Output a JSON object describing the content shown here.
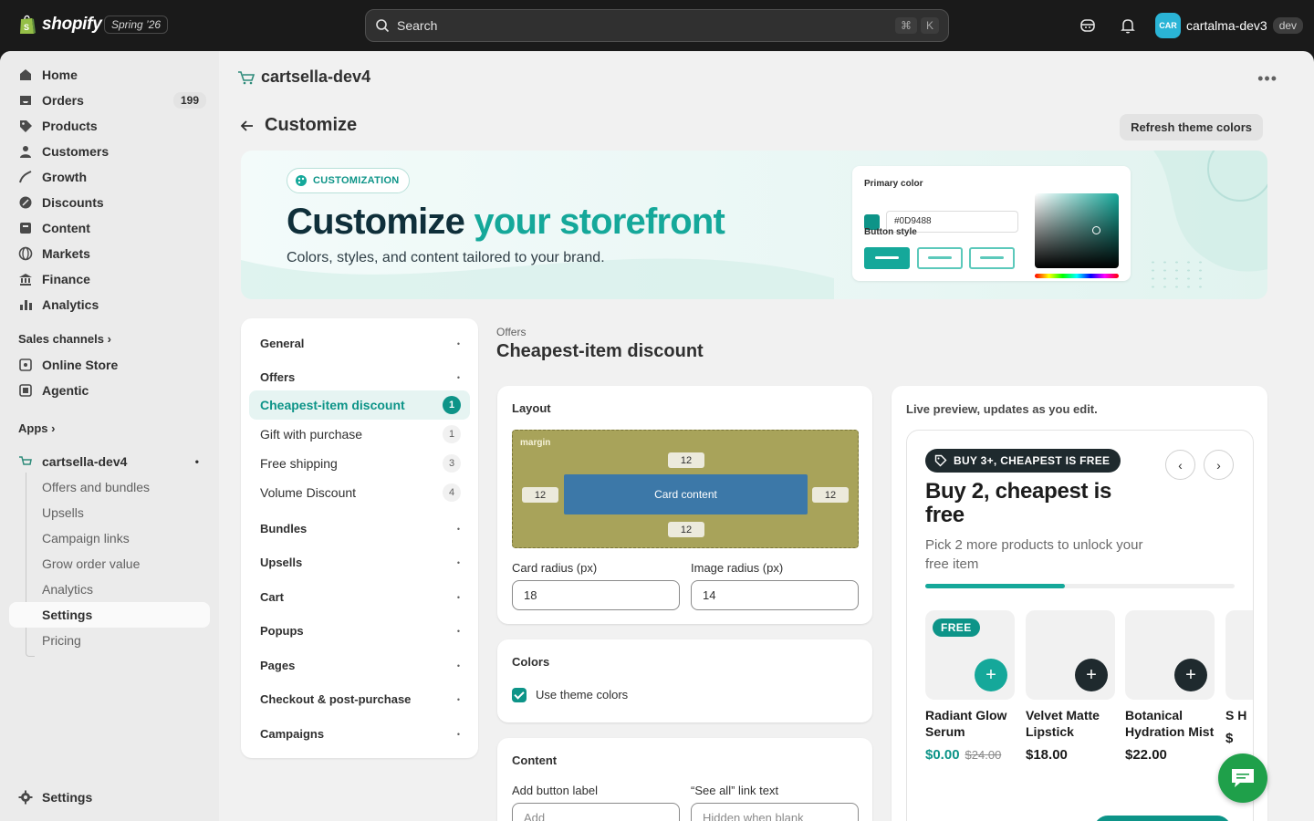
{
  "topbar": {
    "brand": "shopify",
    "edition": "Spring ’26",
    "search_placeholder": "Search",
    "shortcut_cmd": "⌘",
    "shortcut_key": "K",
    "account_initials": "CAR",
    "account_name": "cartalma-dev3",
    "env_badge": "dev"
  },
  "sidebar": {
    "items": [
      {
        "label": "Home",
        "icon": "home-icon"
      },
      {
        "label": "Orders",
        "icon": "orders-icon",
        "count": "199"
      },
      {
        "label": "Products",
        "icon": "tag-icon"
      },
      {
        "label": "Customers",
        "icon": "person-icon"
      },
      {
        "label": "Growth",
        "icon": "growth-icon"
      },
      {
        "label": "Discounts",
        "icon": "discount-icon"
      },
      {
        "label": "Content",
        "icon": "content-icon"
      },
      {
        "label": "Markets",
        "icon": "globe-icon"
      },
      {
        "label": "Finance",
        "icon": "bank-icon"
      },
      {
        "label": "Analytics",
        "icon": "chart-icon"
      }
    ],
    "sales_channels_heading": "Sales channels",
    "channels": [
      {
        "label": "Online Store",
        "icon": "store-icon"
      },
      {
        "label": "Agentic",
        "icon": "agent-icon"
      }
    ],
    "apps_heading": "Apps",
    "app_name": "cartsella-dev4",
    "app_subitems": [
      "Offers and bundles",
      "Upsells",
      "Campaign links",
      "Grow order value",
      "Analytics",
      "Settings",
      "Pricing"
    ],
    "settings_label": "Settings"
  },
  "main": {
    "store_title": "cartsella-dev4",
    "more_label": "•••",
    "page_title": "Customize",
    "refresh_button": "Refresh theme colors"
  },
  "hero": {
    "chip": "CUSTOMIZATION",
    "title_plain": "Customize ",
    "title_accent": "your storefront",
    "subtitle": "Colors, styles, and content tailored to your brand.",
    "primary_color_label": "Primary color",
    "primary_color_hex": "#0D9488",
    "button_style_label": "Button style",
    "accent_color": "#15a89a"
  },
  "settings_nav": {
    "groups": [
      {
        "label": "General"
      },
      {
        "label": "Offers",
        "items": [
          {
            "label": "Cheapest-item discount",
            "count": "1"
          },
          {
            "label": "Gift with purchase",
            "count": "1"
          },
          {
            "label": "Free shipping",
            "count": "3"
          },
          {
            "label": "Volume Discount",
            "count": "4"
          }
        ]
      },
      {
        "label": "Bundles"
      },
      {
        "label": "Upsells"
      },
      {
        "label": "Cart"
      },
      {
        "label": "Popups"
      },
      {
        "label": "Pages"
      },
      {
        "label": "Checkout & post-purchase"
      },
      {
        "label": "Campaigns"
      }
    ]
  },
  "content": {
    "breadcrumb": "Offers",
    "title": "Cheapest-item discount",
    "layout": {
      "title": "Layout",
      "margin_label": "margin",
      "pad_top": "12",
      "pad_bottom": "12",
      "pad_left": "12",
      "pad_right": "12",
      "card_content_label": "Card content",
      "card_radius_label": "Card radius (px)",
      "card_radius_value": "18",
      "image_radius_label": "Image radius (px)",
      "image_radius_value": "14"
    },
    "colors": {
      "title": "Colors",
      "use_theme_colors_label": "Use theme colors",
      "use_theme_colors_checked": true
    },
    "content_card": {
      "title": "Content",
      "add_button_label": "Add button label",
      "add_button_placeholder": "Add",
      "see_all_label": "“See all” link text",
      "see_all_placeholder": "Hidden when blank"
    }
  },
  "preview": {
    "heading": "Live preview, updates as you edit.",
    "pill": "BUY 3+, CHEAPEST IS FREE",
    "title": "Buy 2, cheapest is free",
    "subtitle": "Pick 2 more products to unlock your free item",
    "progress": 0.45,
    "prev_label": "‹",
    "next_label": "›",
    "free_tag": "FREE",
    "products": [
      {
        "name": "Radiant Glow Serum",
        "price": "$0.00",
        "compare": "$24.00"
      },
      {
        "name": "Velvet Matte Lipstick",
        "price": "$18.00"
      },
      {
        "name": "Botanical Hydration Mist",
        "price": "$22.00"
      },
      {
        "name": "S H",
        "price": "$"
      }
    ]
  }
}
